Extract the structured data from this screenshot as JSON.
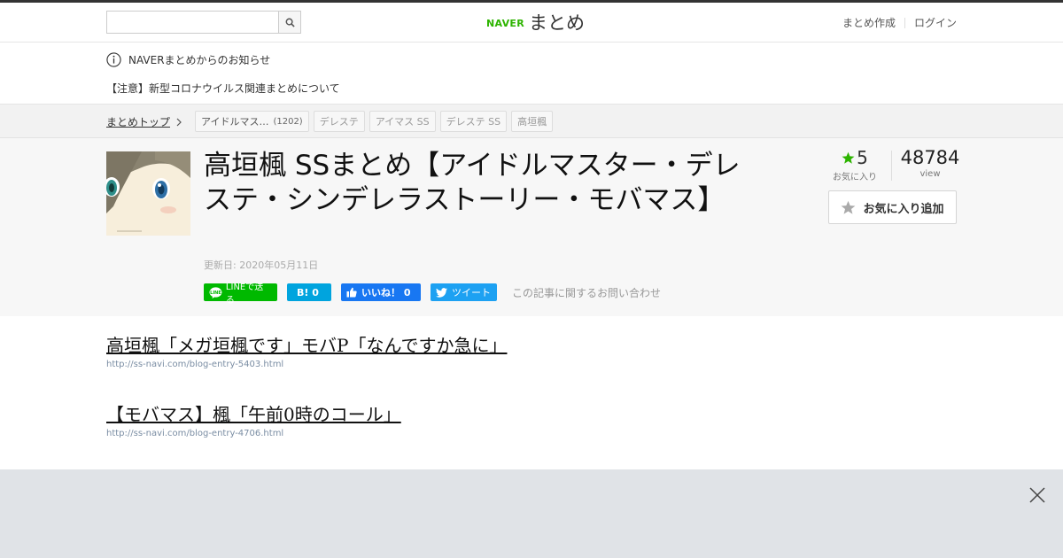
{
  "header": {
    "search": {
      "placeholder": "",
      "value": ""
    },
    "logo_naver": "NAVER",
    "logo_matome": "まとめ",
    "links": [
      "まとめ作成",
      "ログイン"
    ]
  },
  "notice": {
    "heading": "NAVERまとめからのお知らせ",
    "link": "【注意】新型コロナウイルス関連まとめについて"
  },
  "tagbar": {
    "crumb": "まとめトップ",
    "tags": [
      {
        "label": "アイドルマス…",
        "count": "(1202)"
      },
      {
        "label": "デレステ",
        "count": ""
      },
      {
        "label": "アイマス SS",
        "count": ""
      },
      {
        "label": "デレステ SS",
        "count": ""
      },
      {
        "label": "高垣楓",
        "count": ""
      }
    ]
  },
  "article": {
    "title": "高垣楓 SSまとめ【アイドルマスター・デレステ・シンデレラストーリー・モバマス】",
    "updated": "更新日: 2020年05月11日",
    "share": {
      "line": "LINEで送る",
      "hatena": "B! 0",
      "facebook": "いいね！ 0",
      "twitter": "ツイート"
    },
    "contact": "この記事に関するお問い合わせ",
    "fav_count": "5",
    "fav_label": "お気に入り",
    "views": "48784",
    "views_label": "view",
    "fav_button": "お気に入り追加"
  },
  "items": [
    {
      "title": "高垣楓「メガ垣楓です」モバP「なんですか急に」",
      "url": "http://ss-navi.com/blog-entry-5403.html"
    },
    {
      "title": "【モバマス】楓「午前0時のコール」",
      "url": "http://ss-navi.com/blog-entry-4706.html"
    }
  ],
  "colors": {
    "brand": "#2db400",
    "line": "#00b900",
    "hatena": "#00a4de",
    "facebook": "#1877f2",
    "twitter": "#1da1f2"
  },
  "icons": [
    "search-icon",
    "info-icon",
    "chevron-right-icon",
    "star-icon",
    "line-icon",
    "thumbs-up-icon",
    "twitter-bird-icon",
    "close-icon"
  ]
}
